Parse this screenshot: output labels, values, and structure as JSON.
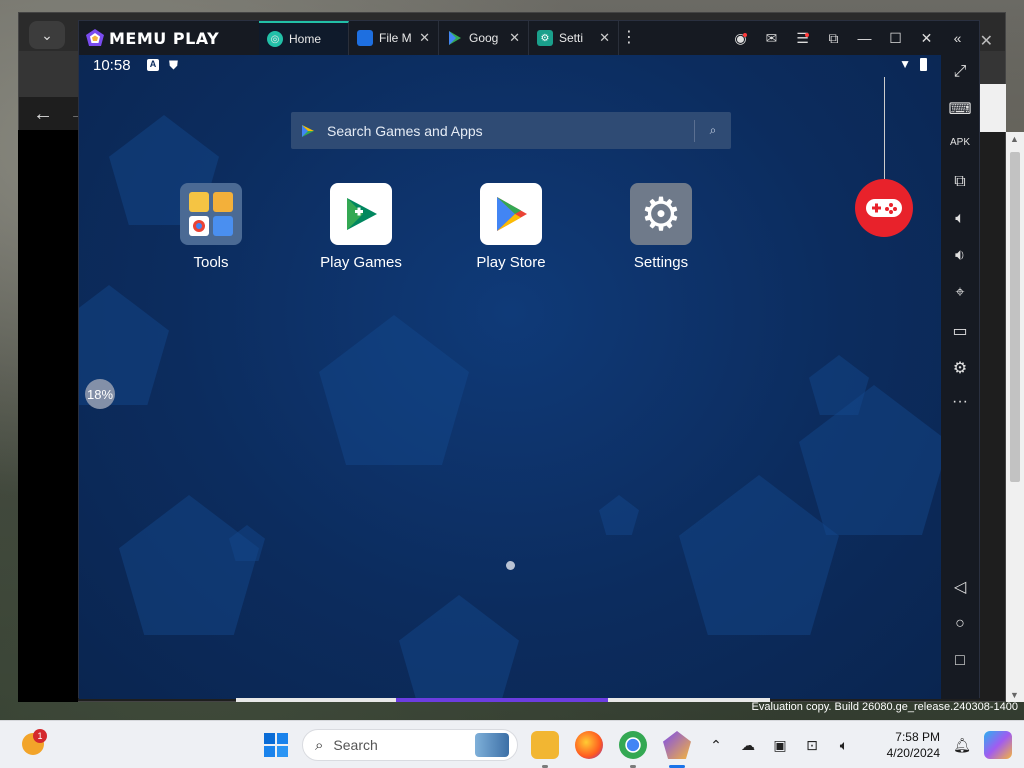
{
  "memu": {
    "brand": "MEMU PLAY",
    "tabs": [
      {
        "label": "Home",
        "active": true
      },
      {
        "label": "File M",
        "active": false
      },
      {
        "label": "Goog",
        "active": false
      },
      {
        "label": "Setti",
        "active": false
      }
    ]
  },
  "android": {
    "time": "10:58",
    "search_placeholder": "Search Games and Apps",
    "apps": [
      {
        "label": "Tools"
      },
      {
        "label": "Play Games"
      },
      {
        "label": "Play Store"
      },
      {
        "label": "Settings"
      }
    ],
    "progress": "18%"
  },
  "desktop": {
    "watermark": "Evaluation copy. Build 26080.ge_release.240308-1400"
  },
  "taskbar": {
    "search_placeholder": "Search",
    "widget_badge": "1",
    "time": "7:58 PM",
    "date": "4/20/2024"
  },
  "colors": {
    "accent_tab": "#22c0a8",
    "android_bg": "#0c2c5e",
    "gamepad": "#e8222b",
    "progress_purple": "#6c3de0"
  }
}
